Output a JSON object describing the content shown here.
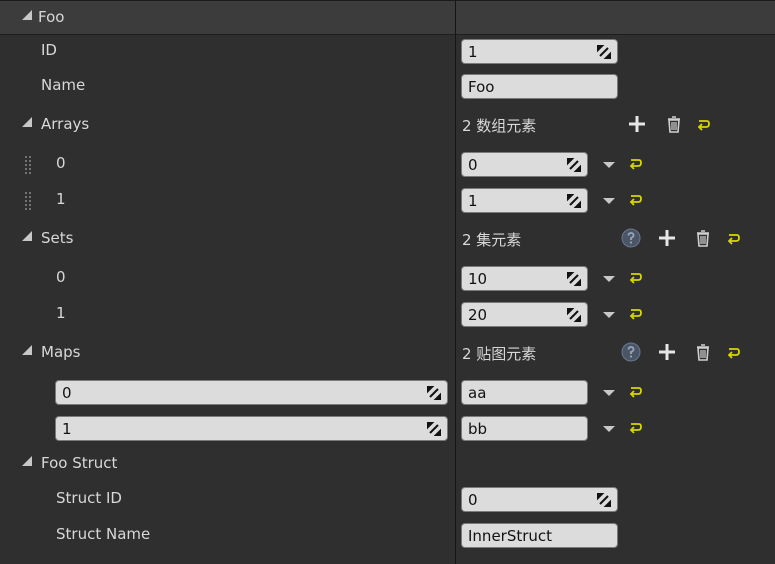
{
  "root": {
    "label": "Foo"
  },
  "props": {
    "id": {
      "label": "ID",
      "value": "1"
    },
    "name": {
      "label": "Name",
      "value": "Foo"
    },
    "arrays": {
      "label": "Arrays",
      "count": "2 数组元素",
      "items": [
        {
          "index": "0",
          "value": "0"
        },
        {
          "index": "1",
          "value": "1"
        }
      ]
    },
    "sets": {
      "label": "Sets",
      "count": "2 集元素",
      "items": [
        {
          "index": "0",
          "value": "10"
        },
        {
          "index": "1",
          "value": "20"
        }
      ]
    },
    "maps": {
      "label": "Maps",
      "count": "2 贴图元素",
      "items": [
        {
          "key": "0",
          "value": "aa"
        },
        {
          "key": "1",
          "value": "bb"
        }
      ]
    },
    "foo_struct": {
      "label": "Foo Struct",
      "struct_id": {
        "label": "Struct ID",
        "value": "0"
      },
      "struct_name": {
        "label": "Struct Name",
        "value": "InnerStruct"
      }
    }
  },
  "colors": {
    "background": "#2f2f2f",
    "header": "#3c3c3c",
    "field": "#dcdcdc",
    "reset_arrow": "#d7d700",
    "icon": "#e6e6e6"
  },
  "icons": [
    "expand-triangle-icon",
    "spinner-icon",
    "dropdown-arrow-icon",
    "reset-to-default-icon",
    "add-icon",
    "delete-icon",
    "help-icon",
    "drag-handle-icon"
  ]
}
